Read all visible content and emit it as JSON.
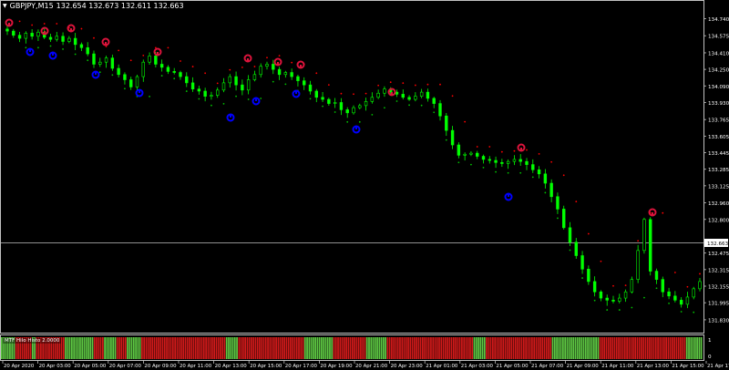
{
  "window": {
    "symbol_title": "GBPJPY,M15",
    "ohlc": "132.654 132.673 132.611 132.663",
    "title_arrow": "▼"
  },
  "price_axis": {
    "labels": [
      "134.740",
      "134.575",
      "134.410",
      "134.250",
      "134.090",
      "133.930",
      "133.765",
      "133.605",
      "133.445",
      "133.285",
      "133.125",
      "132.960",
      "132.800",
      "132.475",
      "132.315",
      "132.155",
      "131.995",
      "131.830"
    ],
    "current_price": "132.663"
  },
  "time_axis": {
    "labels": [
      "20 Apr 2020",
      "20 Apr 03:00",
      "20 Apr 05:00",
      "20 Apr 07:00",
      "20 Apr 09:00",
      "20 Apr 11:00",
      "20 Apr 13:00",
      "20 Apr 15:00",
      "20 Apr 17:00",
      "20 Apr 19:00",
      "20 Apr 21:00",
      "20 Apr 23:00",
      "21 Apr 01:00",
      "21 Apr 03:00",
      "21 Apr 05:00",
      "21 Apr 07:00",
      "21 Apr 09:00",
      "21 Apr 11:00",
      "21 Apr 13:00",
      "21 Apr 15:00",
      "21 Apr 17:00"
    ]
  },
  "indicator": {
    "label": "MTF Hilo Histo 2.0000",
    "axis_labels": [
      "1",
      "0"
    ]
  },
  "colors": {
    "bull": "#00ff00",
    "bear": "#ff0000",
    "upper_dot": "#ff0000",
    "lower_dot": "#00c000",
    "sell_marker": "#dc143c",
    "buy_marker": "#0000ff"
  },
  "chart_data": {
    "type": "candlestick",
    "symbol": "GBPJPY",
    "timeframe": "M15",
    "ylim": [
      131.75,
      134.85
    ],
    "close": [
      134.62,
      134.58,
      134.55,
      134.6,
      134.57,
      134.61,
      134.56,
      134.54,
      134.57,
      134.52,
      134.55,
      134.49,
      134.46,
      134.4,
      134.3,
      134.32,
      134.36,
      134.26,
      134.2,
      134.15,
      134.08,
      134.18,
      134.32,
      134.38,
      134.3,
      134.27,
      134.23,
      134.22,
      134.18,
      134.12,
      134.06,
      134.04,
      133.99,
      134.0,
      134.05,
      134.12,
      134.18,
      134.1,
      134.05,
      134.15,
      134.2,
      134.28,
      134.3,
      134.25,
      134.2,
      134.22,
      134.18,
      134.14,
      134.1,
      134.04,
      133.98,
      133.96,
      133.92,
      133.93,
      133.86,
      133.83,
      133.88,
      133.9,
      133.94,
      133.98,
      134.02,
      134.06,
      134.03,
      134.01,
      133.98,
      133.96,
      133.99,
      134.03,
      133.97,
      133.92,
      133.8,
      133.66,
      133.52,
      133.42,
      133.43,
      133.44,
      133.41,
      133.38,
      133.37,
      133.35,
      133.34,
      133.36,
      133.38,
      133.36,
      133.33,
      133.28,
      133.24,
      133.15,
      133.02,
      132.9,
      132.72,
      132.58,
      132.45,
      132.32,
      132.2,
      132.1,
      132.04,
      132.02,
      132.01,
      132.04,
      132.1,
      132.22,
      132.5,
      132.8,
      132.3,
      132.22,
      132.1,
      132.06,
      132.02,
      131.98,
      132.05,
      132.13,
      132.2
    ],
    "upper_dots_count": 110,
    "lower_dots_count": 110,
    "sell_arrows_count": 11,
    "buy_arrows_count": 9,
    "histogram": [
      "green",
      "green",
      "green",
      "green",
      "green",
      "green",
      "green",
      "red",
      "red",
      "red",
      "red",
      "red",
      "red",
      "red",
      "red",
      "green",
      "green",
      "red",
      "red",
      "red",
      "red",
      "red",
      "red",
      "red",
      "red",
      "red",
      "red",
      "red",
      "red",
      "red",
      "red",
      "green",
      "green",
      "green",
      "green",
      "green",
      "green",
      "green",
      "green",
      "green",
      "green",
      "green",
      "green",
      "green",
      "green",
      "red",
      "red",
      "red",
      "red",
      "red",
      "green",
      "green",
      "green",
      "green",
      "green",
      "green",
      "red",
      "red",
      "red",
      "red",
      "red",
      "green",
      "green",
      "green",
      "green",
      "green",
      "green",
      "green",
      "red",
      "red",
      "red",
      "red",
      "red",
      "red",
      "red",
      "red",
      "red",
      "red",
      "red",
      "red",
      "red",
      "red",
      "red",
      "red",
      "red",
      "red",
      "red",
      "red",
      "red",
      "red",
      "red",
      "red",
      "red",
      "red",
      "red",
      "red",
      "red",
      "red",
      "red",
      "red",
      "red",
      "red",
      "red",
      "red",
      "red",
      "red",
      "red",
      "red",
      "red",
      "green",
      "green",
      "green",
      "green",
      "green",
      "green",
      "red",
      "red",
      "red",
      "red",
      "red",
      "red",
      "red",
      "red",
      "red",
      "red",
      "red",
      "red",
      "red",
      "red",
      "red",
      "red",
      "red",
      "red",
      "red",
      "red",
      "red",
      "red",
      "red",
      "red",
      "red",
      "red",
      "red",
      "red",
      "red",
      "red",
      "red",
      "red",
      "green",
      "green",
      "green",
      "green",
      "green",
      "green",
      "green",
      "green",
      "green",
      "green",
      "green",
      "green",
      "green",
      "green",
      "red",
      "red",
      "red",
      "red",
      "red",
      "red",
      "red",
      "red",
      "red",
      "red",
      "red",
      "red",
      "red",
      "red",
      "red",
      "red",
      "green",
      "green",
      "green",
      "green",
      "green",
      "green",
      "green",
      "green",
      "green",
      "green",
      "red",
      "red",
      "red",
      "red",
      "red",
      "red",
      "red",
      "red",
      "red",
      "red",
      "red",
      "red",
      "red",
      "red",
      "red",
      "red",
      "red",
      "red",
      "red",
      "red",
      "red",
      "red",
      "red",
      "red",
      "red",
      "red",
      "red",
      "red",
      "red",
      "red",
      "red",
      "red",
      "red",
      "red",
      "red",
      "red",
      "red",
      "red",
      "red",
      "red",
      "red",
      "red",
      "green",
      "green",
      "green",
      "green",
      "green",
      "green",
      "red",
      "red",
      "red",
      "red",
      "red",
      "red",
      "red",
      "red",
      "red",
      "red",
      "red",
      "red",
      "red",
      "red",
      "red",
      "red",
      "red",
      "red",
      "red",
      "red",
      "red",
      "red",
      "red",
      "red",
      "red",
      "red",
      "red",
      "red",
      "red",
      "red",
      "red",
      "red",
      "green",
      "green",
      "green",
      "green",
      "green",
      "green",
      "green",
      "green",
      "green",
      "green",
      "green",
      "green",
      "green",
      "green",
      "green",
      "green",
      "green",
      "green",
      "green",
      "green",
      "green",
      "green",
      "green",
      "red",
      "red",
      "red",
      "red",
      "red",
      "red",
      "red",
      "red",
      "red",
      "red",
      "red",
      "red",
      "red",
      "red",
      "red",
      "red",
      "red",
      "red",
      "red",
      "red",
      "red",
      "red",
      "red",
      "red",
      "red",
      "red",
      "red",
      "red",
      "red",
      "red",
      "red",
      "red",
      "red",
      "red",
      "red",
      "red",
      "red",
      "red",
      "red",
      "red",
      "red",
      "red",
      "green",
      "green",
      "green",
      "green",
      "green",
      "green",
      "green",
      "green"
    ]
  }
}
